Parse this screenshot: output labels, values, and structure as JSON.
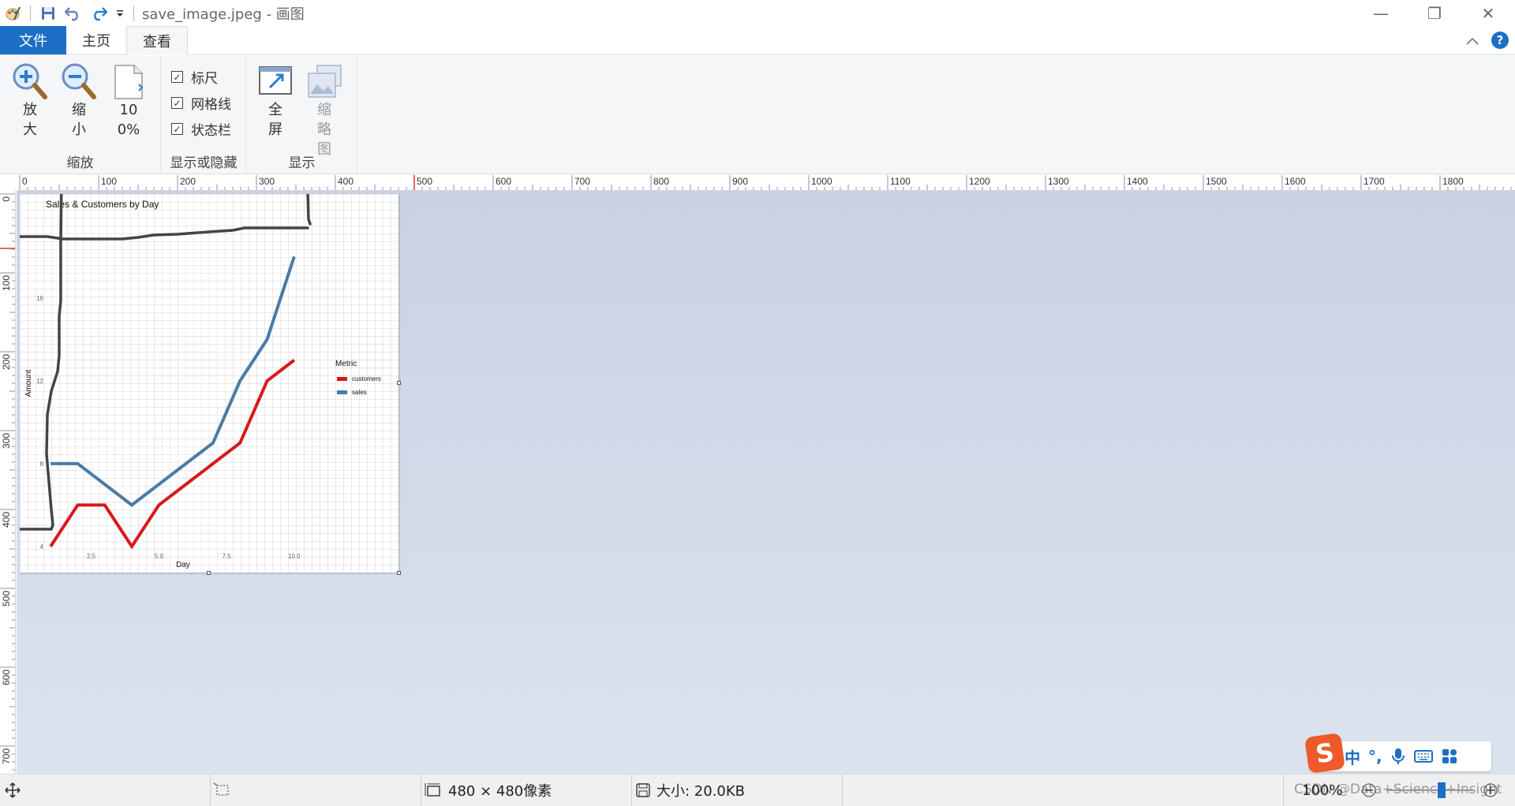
{
  "window": {
    "title": "save_image.jpeg - 画图",
    "controls": [
      "—",
      "❐",
      "✕"
    ]
  },
  "tabs": [
    {
      "label": "文件"
    },
    {
      "label": "主页"
    },
    {
      "label": "查看"
    }
  ],
  "ribbon": {
    "zoom_group": {
      "label": "缩放",
      "zoom_in": "放大",
      "zoom_out": "缩小",
      "actual": "100%"
    },
    "show_hide_group": {
      "label": "显示或隐藏",
      "ruler": "标尺",
      "gridlines": "网格线",
      "statusbar": "状态栏"
    },
    "display_group": {
      "label": "显示",
      "fullscreen": "全屏",
      "thumbnail": "缩略图"
    }
  },
  "ruler": {
    "h_labels": [
      "0",
      "100",
      "200",
      "300",
      "400",
      "500",
      "600",
      "700",
      "800",
      "900",
      "1000",
      "1100",
      "1200",
      "1300",
      "1400",
      "1500",
      "1600",
      "1700",
      "1800"
    ],
    "v_labels": [
      "0",
      "100",
      "200",
      "300",
      "400",
      "500",
      "600",
      "700"
    ]
  },
  "image": {
    "chart_data": {
      "type": "line",
      "title": "Sales & Customers by Day",
      "xlabel": "Day",
      "ylabel": "Amount",
      "x_ticks": [
        "2.5",
        "5.0",
        "7.5",
        "10.0"
      ],
      "y_ticks": [
        "4",
        "8",
        "12",
        "16"
      ],
      "xlim": [
        0.5,
        10.5
      ],
      "ylim": [
        3.5,
        19.5
      ],
      "legend_title": "Metric",
      "legend_placement": "right",
      "x": [
        1,
        2,
        3,
        4,
        5,
        6,
        7,
        8,
        9,
        10
      ],
      "series": [
        {
          "name": "customers",
          "color": "#d7191c",
          "values": [
            4,
            6,
            6,
            4,
            6,
            7,
            8,
            9,
            12,
            13
          ]
        },
        {
          "name": "sales",
          "color": "#4a7ba6",
          "values": [
            8,
            8,
            7,
            6,
            7,
            8,
            9,
            12,
            14,
            18
          ]
        }
      ]
    },
    "annotation_color": "#444444"
  },
  "statusbar": {
    "dimensions": "480 × 480像素",
    "size": "大小: 20.0KB",
    "zoom": "100%",
    "watermark": "CSDN @Data+Science+Insight"
  },
  "ime": {
    "logo": "S",
    "mode": "中",
    "punct": "°,",
    "icons": [
      "microphone-icon",
      "keyboard-icon",
      "apps-icon"
    ]
  }
}
